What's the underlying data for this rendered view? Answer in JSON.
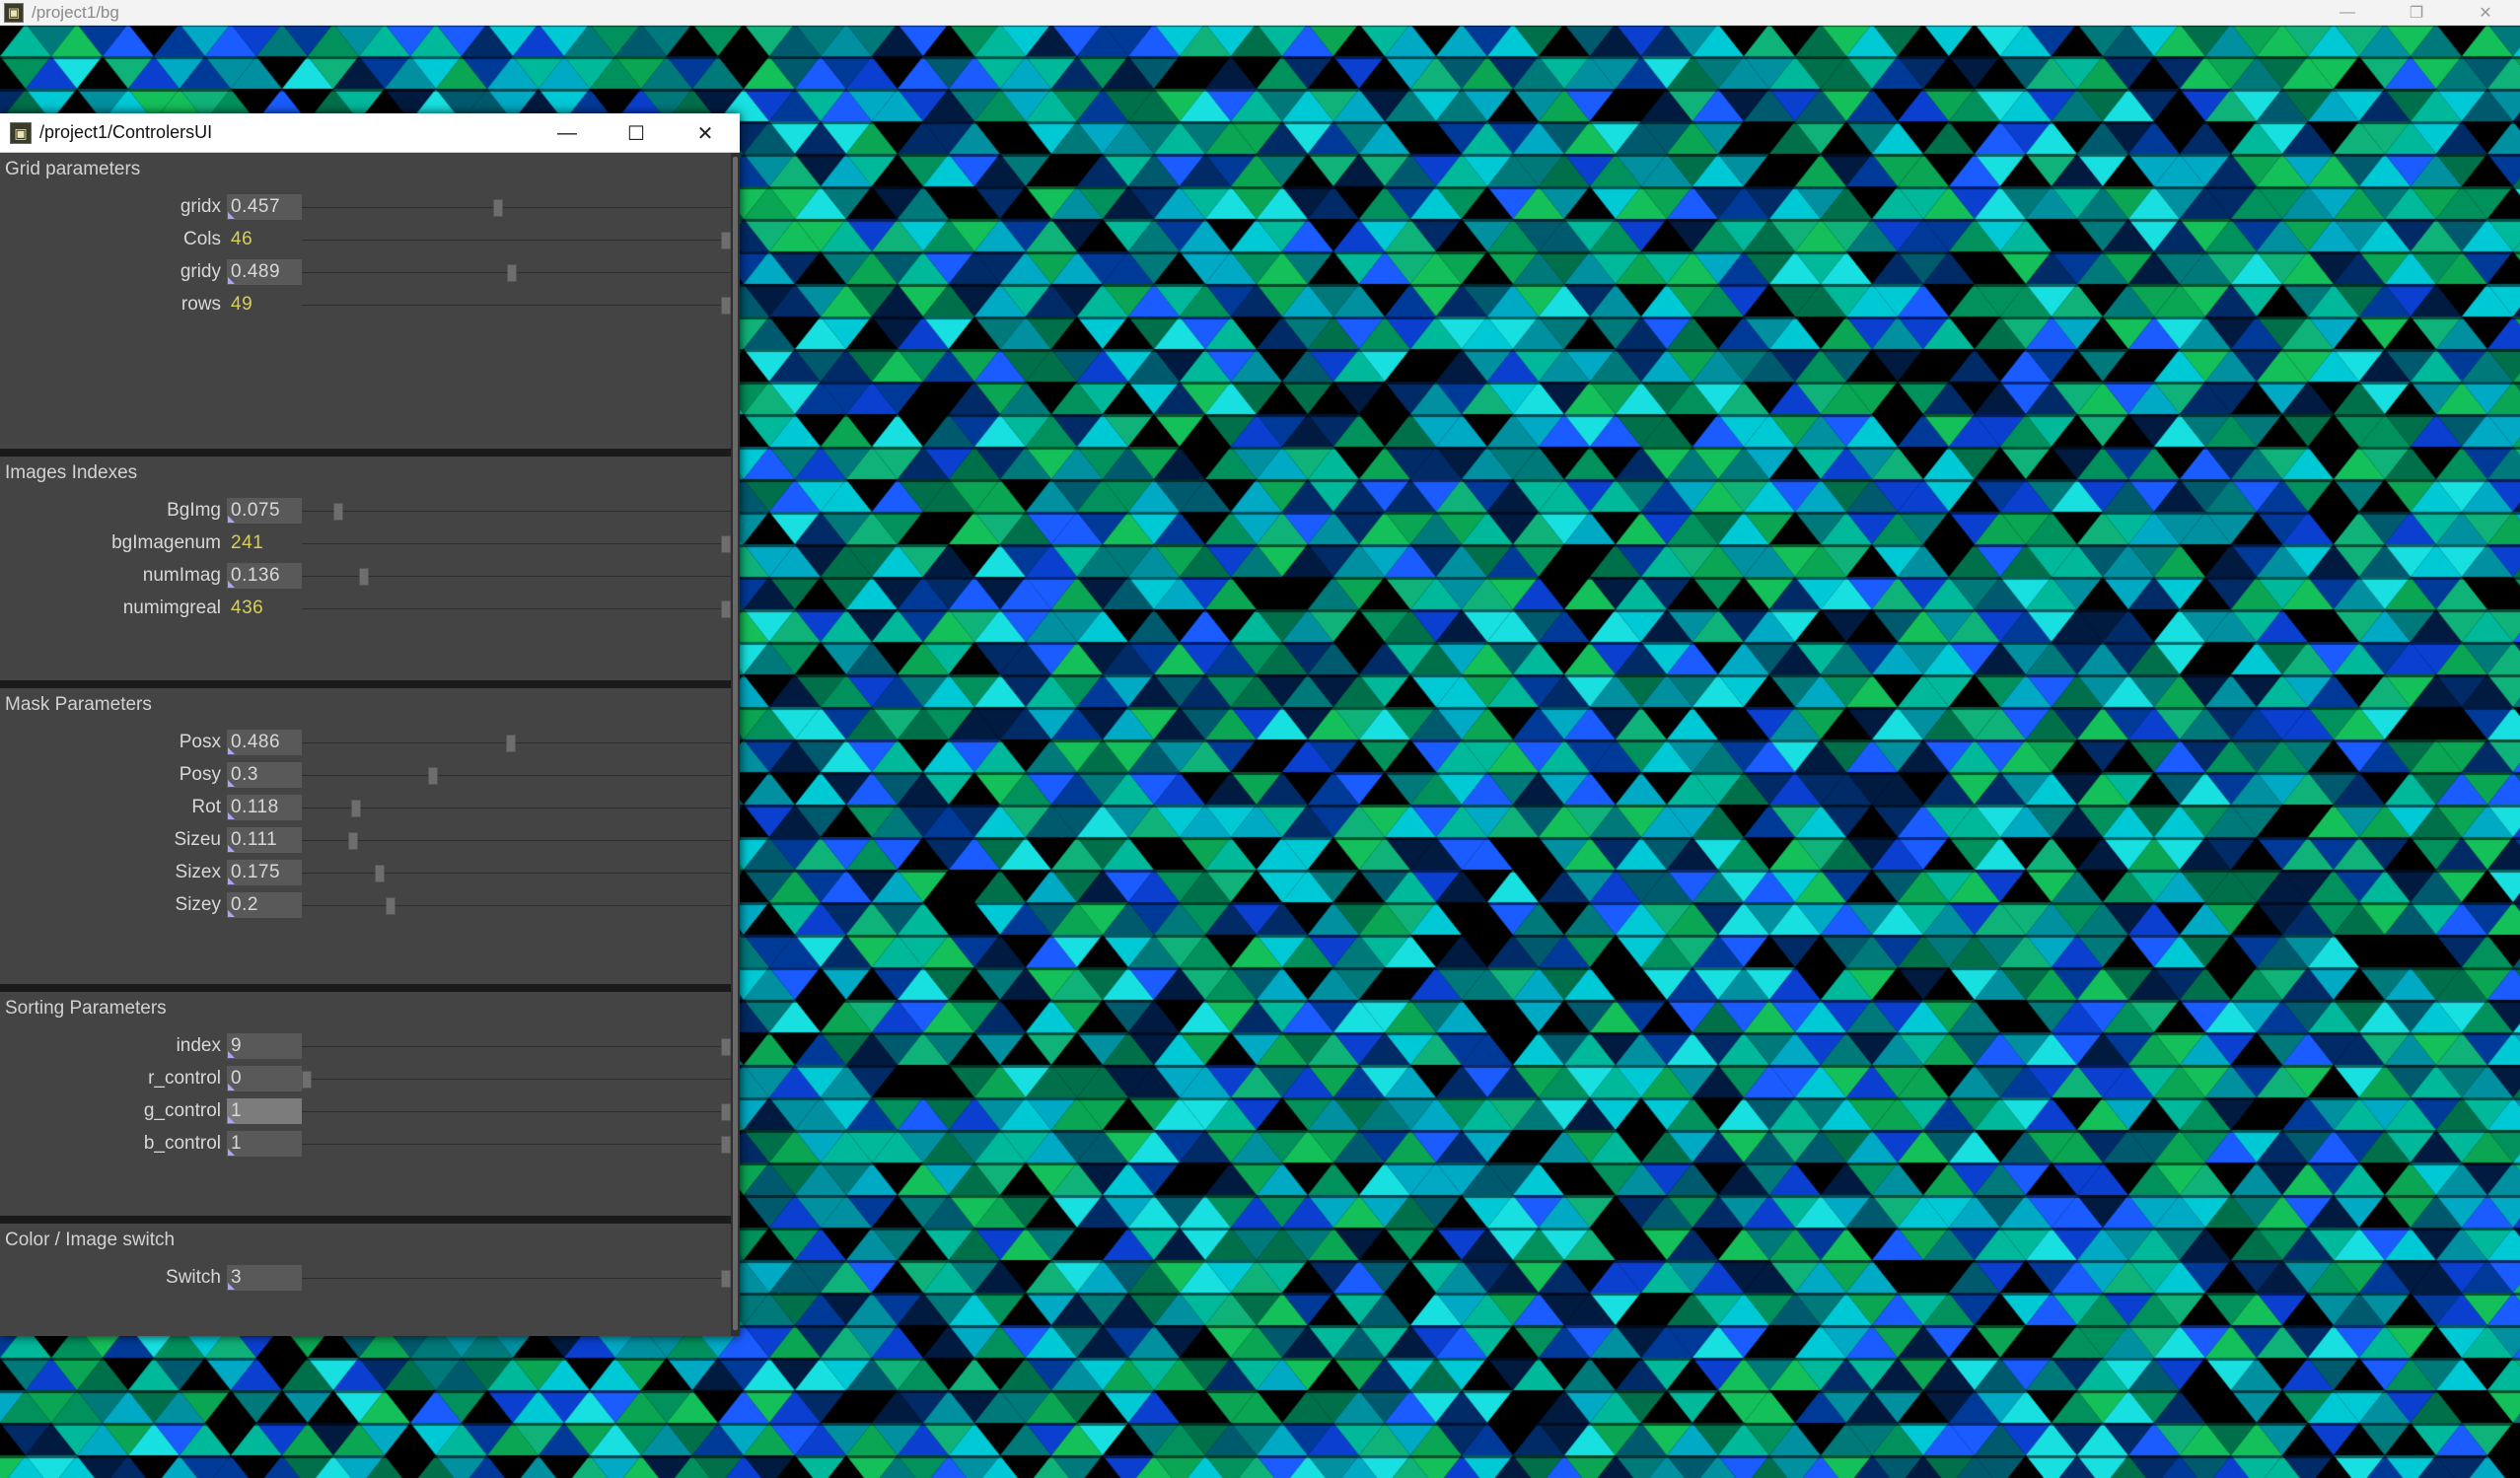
{
  "outer_window": {
    "title": "/project1/bg",
    "icon": "touchdesigner-icon",
    "controls": [
      "minimize",
      "restore",
      "close"
    ],
    "controls_glyphs": [
      "—",
      "❐",
      "✕"
    ]
  },
  "controllers_window": {
    "title": "/project1/ControlersUI",
    "icon": "touchdesigner-icon",
    "controls_glyphs": [
      "—",
      "☐",
      "✕"
    ],
    "groups": [
      {
        "title": "Grid parameters",
        "params": [
          {
            "label": "gridx",
            "value": "0.457",
            "kind": "float",
            "level": 0.457
          },
          {
            "label": "Cols",
            "value": "46",
            "kind": "int",
            "level": 1.0
          },
          {
            "label": "gridy",
            "value": "0.489",
            "kind": "float",
            "level": 0.489
          },
          {
            "label": "rows",
            "value": "49",
            "kind": "int",
            "level": 1.0
          }
        ]
      },
      {
        "title": "Images Indexes",
        "params": [
          {
            "label": "BgImg",
            "value": "0.075",
            "kind": "float",
            "level": 0.075
          },
          {
            "label": "bgImagenum",
            "value": "241",
            "kind": "int",
            "level": 1.0
          },
          {
            "label": "numImag",
            "value": "0.136",
            "kind": "float",
            "level": 0.136
          },
          {
            "label": "numimgreal",
            "value": "436",
            "kind": "int",
            "level": 1.0
          }
        ]
      },
      {
        "title": "Mask Parameters",
        "params": [
          {
            "label": "Posx",
            "value": "0.486",
            "kind": "float",
            "level": 0.486
          },
          {
            "label": "Posy",
            "value": "0.3",
            "kind": "float",
            "level": 0.3
          },
          {
            "label": "Rot",
            "value": "0.118",
            "kind": "float",
            "level": 0.118
          },
          {
            "label": "Sizeu",
            "value": "0.111",
            "kind": "float",
            "level": 0.111
          },
          {
            "label": "Sizex",
            "value": "0.175",
            "kind": "float",
            "level": 0.175
          },
          {
            "label": "Sizey",
            "value": "0.2",
            "kind": "float",
            "level": 0.2
          }
        ]
      },
      {
        "title": "Sorting Parameters",
        "params": [
          {
            "label": "index",
            "value": "9",
            "kind": "field",
            "level": 1.0
          },
          {
            "label": "r_control",
            "value": "0",
            "kind": "field",
            "level": 0.0
          },
          {
            "label": "g_control",
            "value": "1",
            "kind": "field",
            "level": 1.0,
            "highlighted": true
          },
          {
            "label": "b_control",
            "value": "1",
            "kind": "field",
            "level": 1.0
          }
        ]
      },
      {
        "title": "Color / Image switch",
        "params": [
          {
            "label": "Switch",
            "value": "3",
            "kind": "field",
            "level": 1.0
          }
        ]
      }
    ]
  },
  "colors": {
    "panel_bg": "#444444",
    "separator": "#1b1b1b",
    "label_text": "#d8d8d8",
    "int_value": "#d9cf55",
    "value_box": "#595959",
    "value_box_highlight": "#7c7c7c",
    "canvas_palette": [
      "#000000",
      "#001a40",
      "#002b66",
      "#003a99",
      "#0a3fd0",
      "#1a5cff",
      "#005a6e",
      "#00797a",
      "#0090a0",
      "#00a9c4",
      "#00c9d6",
      "#18e0e0",
      "#00704a",
      "#00915c",
      "#0aa653",
      "#14c05a",
      "#0fb37a",
      "#00b89a"
    ]
  }
}
